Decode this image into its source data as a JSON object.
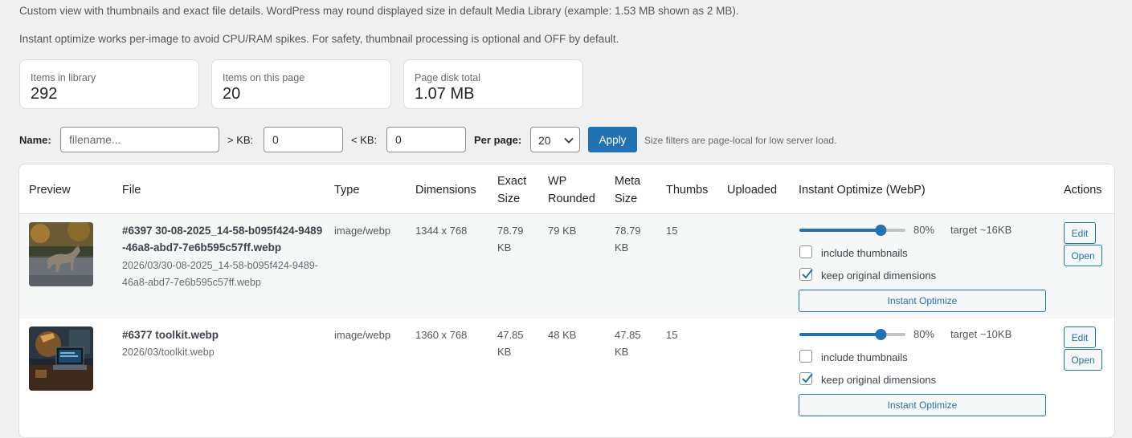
{
  "notices": [
    "Custom view with thumbnails and exact file details. WordPress may round displayed size in default Media Library (example: 1.53 MB shown as 2 MB).",
    "Instant optimize works per-image to avoid CPU/RAM spikes. For safety, thumbnail processing is optional and OFF by default."
  ],
  "stats": [
    {
      "label": "Items in library",
      "value": "292"
    },
    {
      "label": "Items on this page",
      "value": "20"
    },
    {
      "label": "Page disk total",
      "value": "1.07 MB"
    }
  ],
  "filters": {
    "name_label": "Name:",
    "name_placeholder": "filename...",
    "min_kb_label": "> KB:",
    "min_kb_value": "0",
    "max_kb_label": "< KB:",
    "max_kb_value": "0",
    "per_page_label": "Per page:",
    "per_page_value": "20",
    "apply_label": "Apply",
    "hint": "Size filters are page-local for low server load."
  },
  "table": {
    "headers": {
      "preview": "Preview",
      "file": "File",
      "type": "Type",
      "dimensions": "Dimensions",
      "exact_size": "Exact Size",
      "wp_rounded": "WP Rounded",
      "meta_size": "Meta Size",
      "thumbs": "Thumbs",
      "uploaded": "Uploaded",
      "instant_optimize": "Instant Optimize (WebP)",
      "actions": "Actions"
    },
    "rows": [
      {
        "title": "#6397 30-08-2025_14-58-b095f424-9489-46a8-abd7-7e6b595c57ff.webp",
        "path": "2026/03/30-08-2025_14-58-b095f424-9489-46a8-abd7-7e6b595c57ff.webp",
        "type": "image/webp",
        "dimensions": "1344 x 768",
        "exact_size": "78.79 KB",
        "wp_rounded": "79 KB",
        "meta_size": "78.79 KB",
        "thumbs": "15",
        "uploaded": "",
        "quality_label": "80%",
        "quality": 80,
        "target": "target ~16KB",
        "include_thumbnails_label": "include thumbnails",
        "include_thumbnails": false,
        "keep_dimensions_label": "keep original dimensions",
        "keep_dimensions": true,
        "optimize_label": "Instant Optimize",
        "edit_label": "Edit",
        "open_label": "Open",
        "thumbnail": "wolf-on-road-image"
      },
      {
        "title": "#6377 toolkit.webp",
        "path": "2026/03/toolkit.webp",
        "type": "image/webp",
        "dimensions": "1360 x 768",
        "exact_size": "47.85 KB",
        "wp_rounded": "48 KB",
        "meta_size": "47.85 KB",
        "thumbs": "15",
        "uploaded": "",
        "quality_label": "80%",
        "quality": 80,
        "target": "target ~10KB",
        "include_thumbnails_label": "include thumbnails",
        "include_thumbnails": false,
        "keep_dimensions_label": "keep original dimensions",
        "keep_dimensions": true,
        "optimize_label": "Instant Optimize",
        "edit_label": "Edit",
        "open_label": "Open",
        "thumbnail": "desk-with-laptop-and-lamp-image"
      }
    ]
  },
  "colors": {
    "accent": "#2271b1",
    "background": "#f0f0f1"
  }
}
